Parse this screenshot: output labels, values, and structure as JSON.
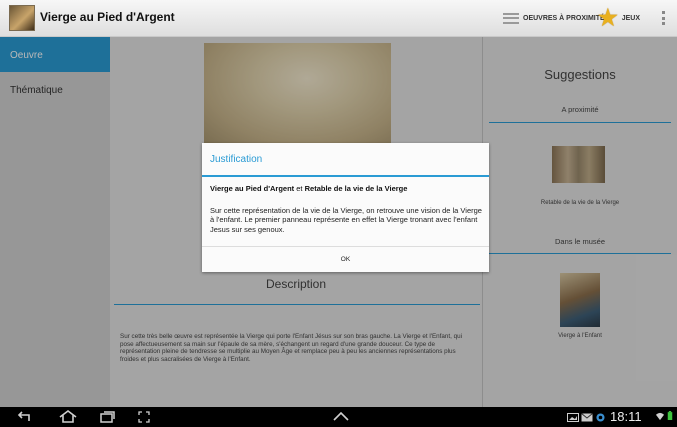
{
  "app": {
    "title": "Vierge au Pied d'Argent"
  },
  "actionbar": {
    "nearby_label": "OEUVRES À PROXIMITÉ",
    "games_label": "JEUX",
    "icons": [
      "list-icon",
      "star-icon",
      "overflow-icon"
    ]
  },
  "sidebar": {
    "items": [
      {
        "label": "Oeuvre",
        "active": true
      },
      {
        "label": "Thématique",
        "active": false
      }
    ]
  },
  "main": {
    "description_title": "Description",
    "description_text": "Sur cette très belle œuvre est représentée la Vierge qui porte l'Enfant Jésus sur son bras gauche. La Vierge et l'Enfant, qui pose affectueusement sa main sur l'épaule de sa mère, s'échangent un regard d'une grande douceur. Ce type de représentation pleine de tendresse se multiplie au Moyen Âge et remplace peu à peu les anciennes représentations plus froides et plus sacralisées de Vierge à l'Enfant."
  },
  "suggestions": {
    "title": "Suggestions",
    "nearby_heading": "A proximité",
    "nearby_item": "Retable de la vie de la Vierge",
    "museum_heading": "Dans le musée",
    "museum_item": "Vierge à l'Enfant"
  },
  "dialog": {
    "title": "Justification",
    "artwork_a": "Vierge au Pied d'Argent",
    "conjunction": " et ",
    "artwork_b": "Retable de la vie de la Vierge",
    "body": "Sur cette représentation de la vie de la Vierge, on retrouve une vision de la Vierge à l'enfant. Le premier panneau représente en effet la Vierge tronant avec l'enfant Jesus sur ses genoux.",
    "ok_label": "OK"
  },
  "navbar": {
    "time": "18:11"
  },
  "colors": {
    "accent": "#2a9bd4"
  }
}
